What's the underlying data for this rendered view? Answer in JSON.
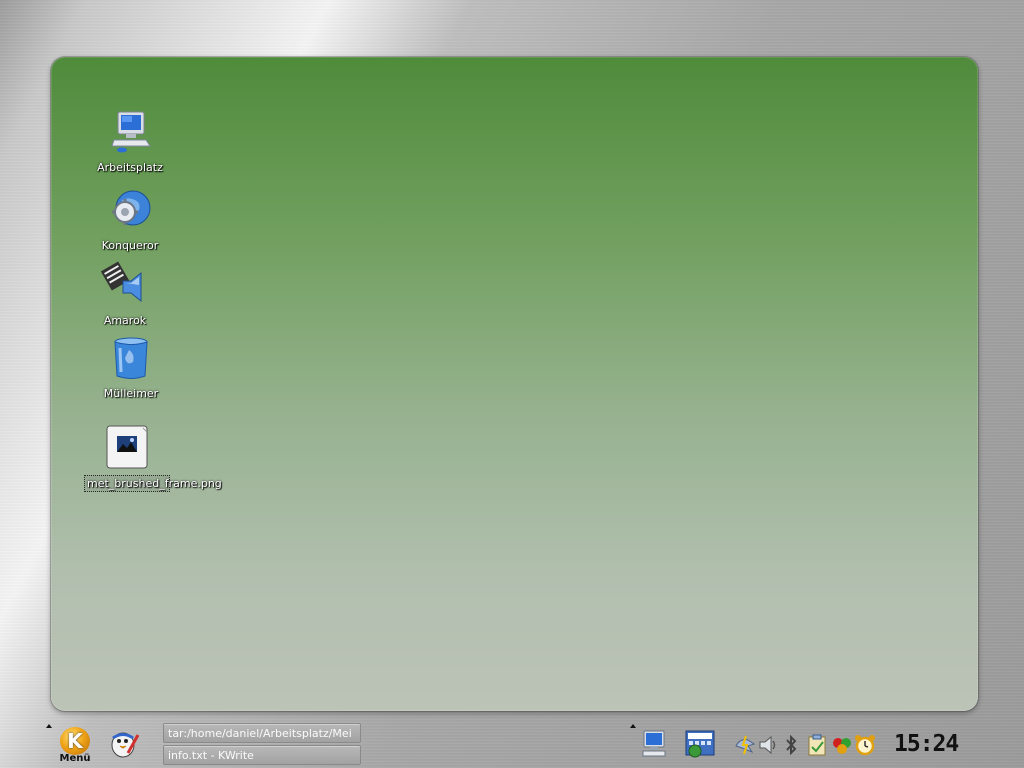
{
  "desktop": {
    "icons": [
      {
        "label": "Arbeitsplatz",
        "icon": "computer-icon"
      },
      {
        "label": "Konqueror",
        "icon": "konqueror-icon"
      },
      {
        "label": "Amarok",
        "icon": "amarok-icon"
      },
      {
        "label": "Mülleimer",
        "icon": "trash-icon"
      },
      {
        "label": "met_brushed_frame.png",
        "icon": "image-file-icon"
      }
    ]
  },
  "taskbar": {
    "kmenu_label": "Menü",
    "tasks": [
      {
        "title": "tar:/home/daniel/Arbeitsplatz/Mei"
      },
      {
        "title": "info.txt - KWrite"
      }
    ],
    "tray_icons": [
      "show-desktop-icon",
      "network-icon",
      "flash-icon",
      "volume-icon",
      "bluetooth-icon",
      "clipboard-icon",
      "hearts-icon",
      "alarm-clock-icon"
    ],
    "clock": "15:24"
  },
  "colors": {
    "desktop_top": "#4f8b3b",
    "desktop_bottom": "#bcc3b7"
  }
}
